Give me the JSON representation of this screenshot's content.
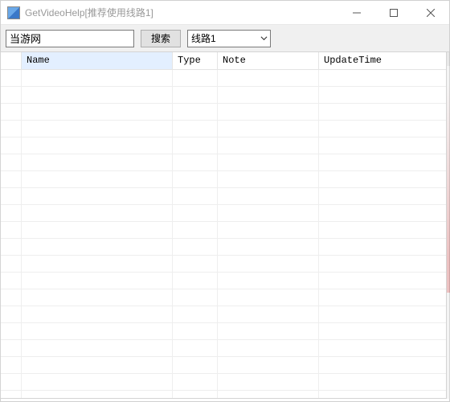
{
  "window": {
    "title": "GetVideoHelp[推荐使用线路1]"
  },
  "toolbar": {
    "search_value": "当游网",
    "search_button": "搜索",
    "route_selected": "线路1",
    "route_options": [
      "线路1"
    ]
  },
  "table": {
    "columns": {
      "name": "Name",
      "type": "Type",
      "note": "Note",
      "update": "UpdateTime"
    },
    "rows": []
  }
}
